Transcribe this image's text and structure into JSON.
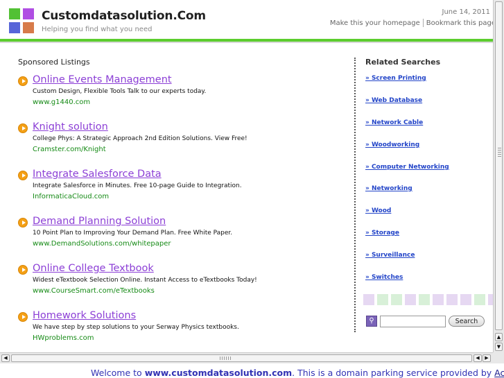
{
  "header": {
    "title": "Customdatasolution.Com",
    "tagline": "Helping you find what you need",
    "date": "June 14, 2011",
    "links": [
      "Make this your homepage",
      "Bookmark this page"
    ],
    "logo_colors": [
      "#52c134",
      "#b04ee3",
      "#5765d8",
      "#d77b4a"
    ],
    "accent_color": "#5ccd2e"
  },
  "sponsored": {
    "heading": "Sponsored Listings",
    "items": [
      {
        "title": "Online Events Management",
        "description": "Custom Design, Flexible Tools Talk to our experts today.",
        "url": "www.g1440.com"
      },
      {
        "title": "Knight solution",
        "description": "College Phys: A Strategic Approach 2nd Edition Solutions. View Free!",
        "url": "Cramster.com/Knight"
      },
      {
        "title": "Integrate Salesforce Data",
        "description": "Integrate Salesforce in Minutes. Free 10-page Guide to Integration.",
        "url": "InformaticaCloud.com"
      },
      {
        "title": "Demand Planning Solution",
        "description": "10 Point Plan to Improving Your Demand Plan. Free White Paper.",
        "url": "www.DemandSolutions.com/whitepaper"
      },
      {
        "title": "Online College Textbook",
        "description": "Widest eTextbook Selection Online. Instant Access to eTextbooks Today!",
        "url": "www.CourseSmart.com/eTextbooks"
      },
      {
        "title": "Homework Solutions",
        "description": "We have step by step solutions to your Serway Physics textbooks.",
        "url": "HWproblems.com"
      }
    ]
  },
  "related": {
    "heading": "Related Searches",
    "items": [
      "» Screen Printing",
      "» Web Database",
      "» Network Cable",
      "» Woodworking",
      "» Computer Networking",
      "» Networking",
      "» Wood",
      "» Storage",
      "» Surveillance",
      "» Switches"
    ],
    "swatch_colors": [
      "#e6d8f2",
      "#d8f0d8",
      "#d8f0d8",
      "#e6d8f2",
      "#d8f0d8",
      "#e6d8f2",
      "#e6d8f2",
      "#e6d8f2",
      "#d8f0d8",
      "#e6d8f2"
    ]
  },
  "search": {
    "placeholder": "",
    "button_label": "Search",
    "icon": "magnifier-icon"
  },
  "footer": {
    "prefix": "Welcome to ",
    "domain": "www.customdatasolution.com",
    "middle": ". This is a domain parking service provided by ",
    "link": "Active-"
  }
}
